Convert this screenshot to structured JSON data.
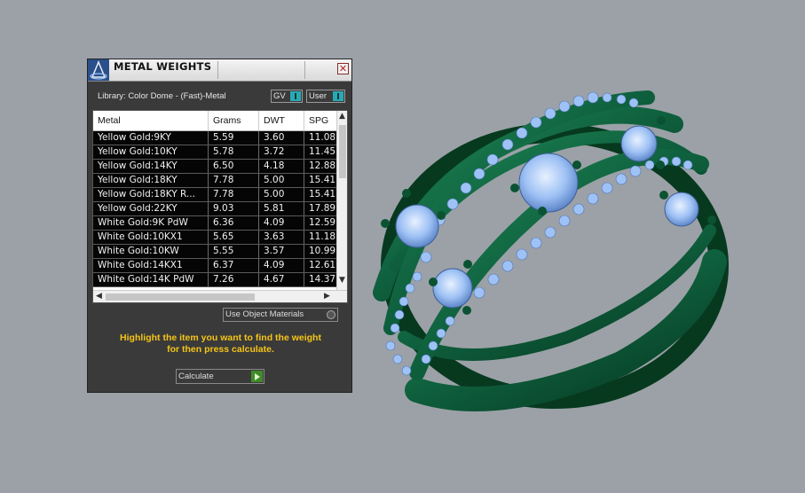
{
  "panel": {
    "title": "METAL WEIGHTS",
    "close_glyph": "✕",
    "library": "Library: Color Dome - (Fast)-Metal",
    "gv_label": "GV",
    "user_label": "User",
    "columns": [
      "Metal",
      "Grams",
      "DWT",
      "SPG"
    ],
    "rows": [
      {
        "metal": "Yellow Gold:9KY",
        "grams": "5.59",
        "dwt": "3.60",
        "spg": "11.08"
      },
      {
        "metal": "Yellow Gold:10KY",
        "grams": "5.78",
        "dwt": "3.72",
        "spg": "11.45"
      },
      {
        "metal": "Yellow Gold:14KY",
        "grams": "6.50",
        "dwt": "4.18",
        "spg": "12.88"
      },
      {
        "metal": "Yellow Gold:18KY",
        "grams": "7.78",
        "dwt": "5.00",
        "spg": "15.41"
      },
      {
        "metal": "Yellow Gold:18KY R...",
        "grams": "7.78",
        "dwt": "5.00",
        "spg": "15.41"
      },
      {
        "metal": "Yellow Gold:22KY",
        "grams": "9.03",
        "dwt": "5.81",
        "spg": "17.89"
      },
      {
        "metal": "White Gold:9K PdW",
        "grams": "6.36",
        "dwt": "4.09",
        "spg": "12.59"
      },
      {
        "metal": "White Gold:10KX1",
        "grams": "5.65",
        "dwt": "3.63",
        "spg": "11.18"
      },
      {
        "metal": "White Gold:10KW",
        "grams": "5.55",
        "dwt": "3.57",
        "spg": "10.99"
      },
      {
        "metal": "White Gold:14KX1",
        "grams": "6.37",
        "dwt": "4.09",
        "spg": "12.61"
      },
      {
        "metal": "White Gold:14K PdW",
        "grams": "7.26",
        "dwt": "4.67",
        "spg": "14.37"
      }
    ],
    "use_object_materials": "Use Object Materials",
    "instructions_line1": "Highlight the item you want to find the weight",
    "instructions_line2": "for then press calculate.",
    "calculate_label": "Calculate"
  },
  "colors": {
    "viewport_bg": "#9ba1a7",
    "ring_metal": "#0e5e3c",
    "gem": "#8fb8f0",
    "accent_yellow": "#f5c518",
    "toggle_teal": "#29a9b3",
    "go_green": "#3f8b2a"
  },
  "icons": [
    "app-logo-icon",
    "close-icon",
    "scroll-up-icon",
    "scroll-down-icon",
    "scroll-left-icon",
    "scroll-right-icon",
    "play-icon"
  ]
}
